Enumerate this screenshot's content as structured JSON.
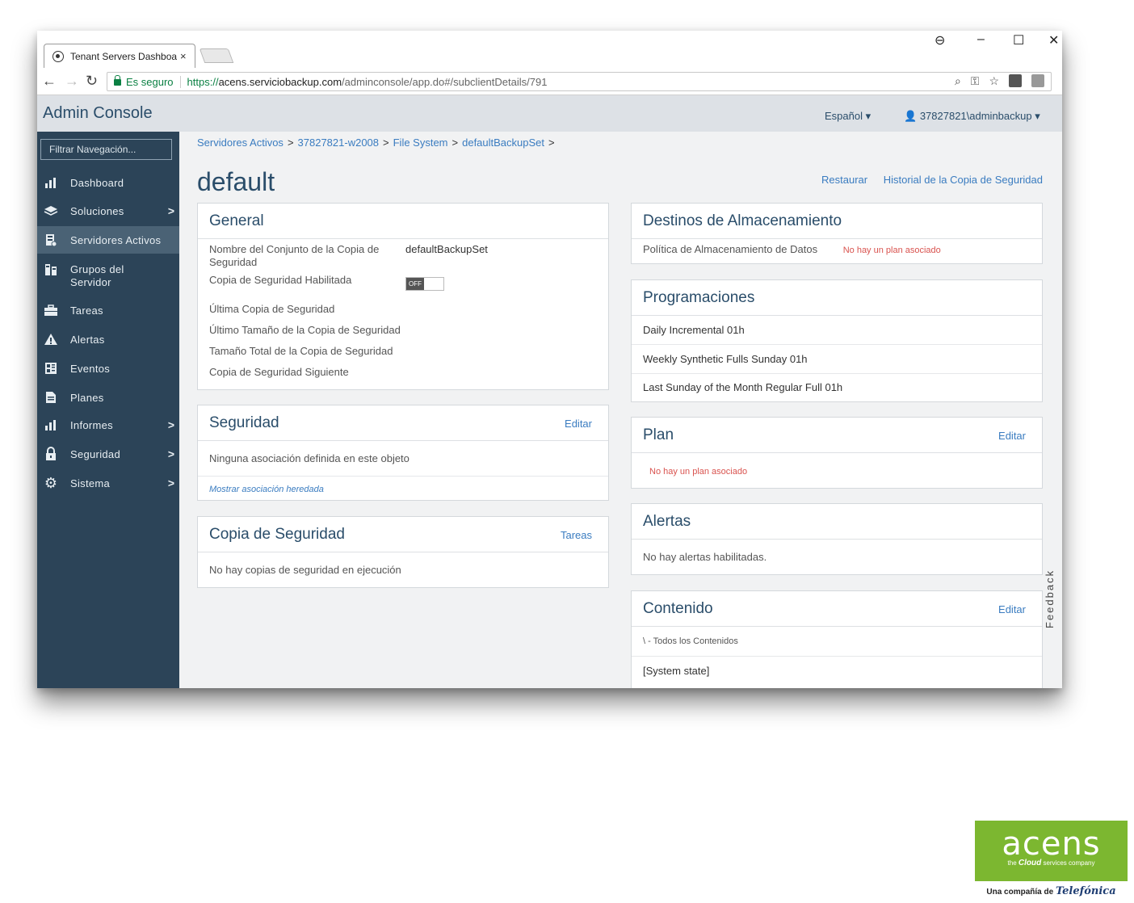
{
  "browser": {
    "tab_title": "Tenant Servers Dashboar",
    "tab_close": "×",
    "secure_label": "Es seguro",
    "url_scheme": "https://",
    "url_host": "acens.serviciobackup.com",
    "url_path": "/adminconsole/app.do#/subclientDetails/791",
    "window_controls": [
      "⊖",
      "–",
      "☐",
      "✕"
    ]
  },
  "header": {
    "app_title": "Admin Console",
    "language": "Español ▾",
    "user": "37827821\\adminbackup ▾"
  },
  "sidebar": {
    "filter_placeholder": "Filtrar Navegación...",
    "items": [
      {
        "label": "Dashboard",
        "icon": "dashboard-icon",
        "glyph": "📊",
        "chevron": ""
      },
      {
        "label": "Soluciones",
        "icon": "layers-icon",
        "glyph": "≋",
        "chevron": "›"
      },
      {
        "label": "Servidores Activos",
        "icon": "server-icon",
        "glyph": "▤",
        "chevron": "",
        "active": true
      },
      {
        "label": "Grupos del Servidor",
        "icon": "server-group-icon",
        "glyph": "▦",
        "chevron": ""
      },
      {
        "label": "Tareas",
        "icon": "briefcase-icon",
        "glyph": "▬",
        "chevron": ""
      },
      {
        "label": "Alertas",
        "icon": "warning-icon",
        "glyph": "▲",
        "chevron": ""
      },
      {
        "label": "Eventos",
        "icon": "events-icon",
        "glyph": "▣",
        "chevron": ""
      },
      {
        "label": "Planes",
        "icon": "plan-icon",
        "glyph": "▥",
        "chevron": ""
      },
      {
        "label": "Informes",
        "icon": "reports-icon",
        "glyph": "📊",
        "chevron": "›"
      },
      {
        "label": "Seguridad",
        "icon": "lock-icon",
        "glyph": "🔒",
        "chevron": "›"
      },
      {
        "label": "Sistema",
        "icon": "gear-icon",
        "glyph": "⚙",
        "chevron": "›"
      }
    ]
  },
  "breadcrumb": [
    "Servidores Activos",
    "37827821-w2008",
    "File System",
    "defaultBackupSet"
  ],
  "breadcrumb_sep": ">",
  "page": {
    "title": "default",
    "restore_link": "Restaurar",
    "history_link": "Historial de la Copia de Seguridad"
  },
  "general": {
    "title": "General",
    "backupset_label": "Nombre del Conjunto de la Copia de Seguridad",
    "backupset_value": "defaultBackupSet",
    "enabled_label": "Copia de Seguridad Habilitada",
    "toggle_state": "OFF",
    "last_backup_label": "Última Copia de Seguridad",
    "last_size_label": "Último Tamaño de la Copia de Seguridad",
    "total_size_label": "Tamaño Total de la Copia de Seguridad",
    "next_backup_label": "Copia de Seguridad Siguiente"
  },
  "security": {
    "title": "Seguridad",
    "edit": "Editar",
    "message": "Ninguna asociación definida en este objeto",
    "inherited_link": "Mostrar asociación heredada"
  },
  "backup": {
    "title": "Copia de Seguridad",
    "tasks_link": "Tareas",
    "message": "No hay copias de seguridad en ejecución"
  },
  "storage": {
    "title": "Destinos de Almacenamiento",
    "policy_label": "Política de Almacenamiento de Datos",
    "policy_value": "No hay un plan asociado"
  },
  "schedules": {
    "title": "Programaciones",
    "items": [
      "Daily Incremental 01h",
      "Weekly Synthetic Fulls Sunday 01h",
      "Last Sunday of the Month Regular Full 01h"
    ]
  },
  "plan": {
    "title": "Plan",
    "edit": "Editar",
    "message": "No hay un plan asociado"
  },
  "alerts": {
    "title": "Alertas",
    "message": "No hay alertas habilitadas."
  },
  "content_panel": {
    "title": "Contenido",
    "edit": "Editar",
    "item_prefix": "\\ -",
    "item_all": "Todos los Contenidos",
    "item_system": "[System state]"
  },
  "feedback_tab": "Feedback",
  "logo": {
    "word": "acens",
    "tagline_pre": "the",
    "tagline_cloud": "Cloud",
    "tagline_post": "services company",
    "under_pre": "Una compañía de",
    "under_brand": "Telefónica"
  },
  "colors": {
    "sidebar_bg": "#2c4458",
    "sidebar_active": "#4a6275",
    "link": "#3a7cc0",
    "title": "#2a4d6a",
    "alert_red": "#d9534f",
    "logo_green": "#7cb730"
  }
}
